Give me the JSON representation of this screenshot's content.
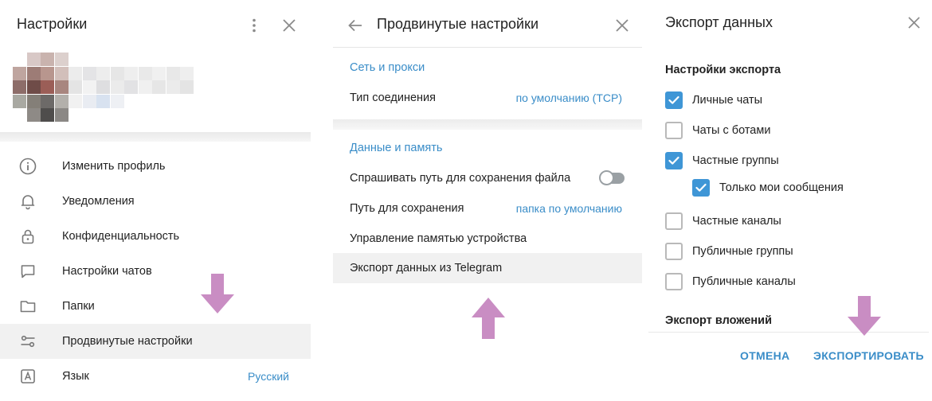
{
  "colors": {
    "accent": "#3a8dc8",
    "checkbox_checked": "#3f96d6",
    "hint_arrow": "#c98dc3",
    "active_row": "#f1f1f1"
  },
  "settings_panel": {
    "title": "Настройки",
    "more_icon": "vertical-dots-icon",
    "close_icon": "close-icon",
    "menu": [
      {
        "icon": "info-icon",
        "label": "Изменить профиль"
      },
      {
        "icon": "bell-icon",
        "label": "Уведомления"
      },
      {
        "icon": "lock-icon",
        "label": "Конфиденциальность"
      },
      {
        "icon": "chat-bubble-icon",
        "label": "Настройки чатов"
      },
      {
        "icon": "folder-icon",
        "label": "Папки"
      },
      {
        "icon": "sliders-icon",
        "label": "Продвинутые настройки",
        "active": true
      },
      {
        "icon": "language-icon",
        "label": "Язык",
        "value": "Русский"
      }
    ]
  },
  "advanced_panel": {
    "title": "Продвинутые настройки",
    "back_icon": "back-arrow-icon",
    "close_icon": "close-icon",
    "network_section": {
      "title": "Сеть и прокси",
      "connection_type_label": "Тип соединения",
      "connection_type_value": "по умолчанию (TCP)"
    },
    "data_section": {
      "title": "Данные и память",
      "ask_path_label": "Спрашивать путь для сохранения файла",
      "ask_path_enabled": false,
      "save_path_label": "Путь для сохранения",
      "save_path_value": "папка по умолчанию",
      "storage_label": "Управление памятью устройства",
      "export_label": "Экспорт данных из Telegram"
    }
  },
  "export_panel": {
    "title": "Экспорт данных",
    "close_icon": "close-icon",
    "settings_title": "Настройки экспорта",
    "options": [
      {
        "label": "Личные чаты",
        "checked": true,
        "indent": false
      },
      {
        "label": "Чаты с ботами",
        "checked": false,
        "indent": false
      },
      {
        "label": "Частные группы",
        "checked": true,
        "indent": false
      },
      {
        "label": "Только мои сообщения",
        "checked": true,
        "indent": true
      },
      {
        "label": "Частные каналы",
        "checked": false,
        "indent": false
      },
      {
        "label": "Публичные группы",
        "checked": false,
        "indent": false
      },
      {
        "label": "Публичные каналы",
        "checked": false,
        "indent": false
      }
    ],
    "attachments_title": "Экспорт вложений",
    "cancel_label": "ОТМЕНА",
    "export_label": "ЭКСПОРТИРОВАТЬ"
  }
}
